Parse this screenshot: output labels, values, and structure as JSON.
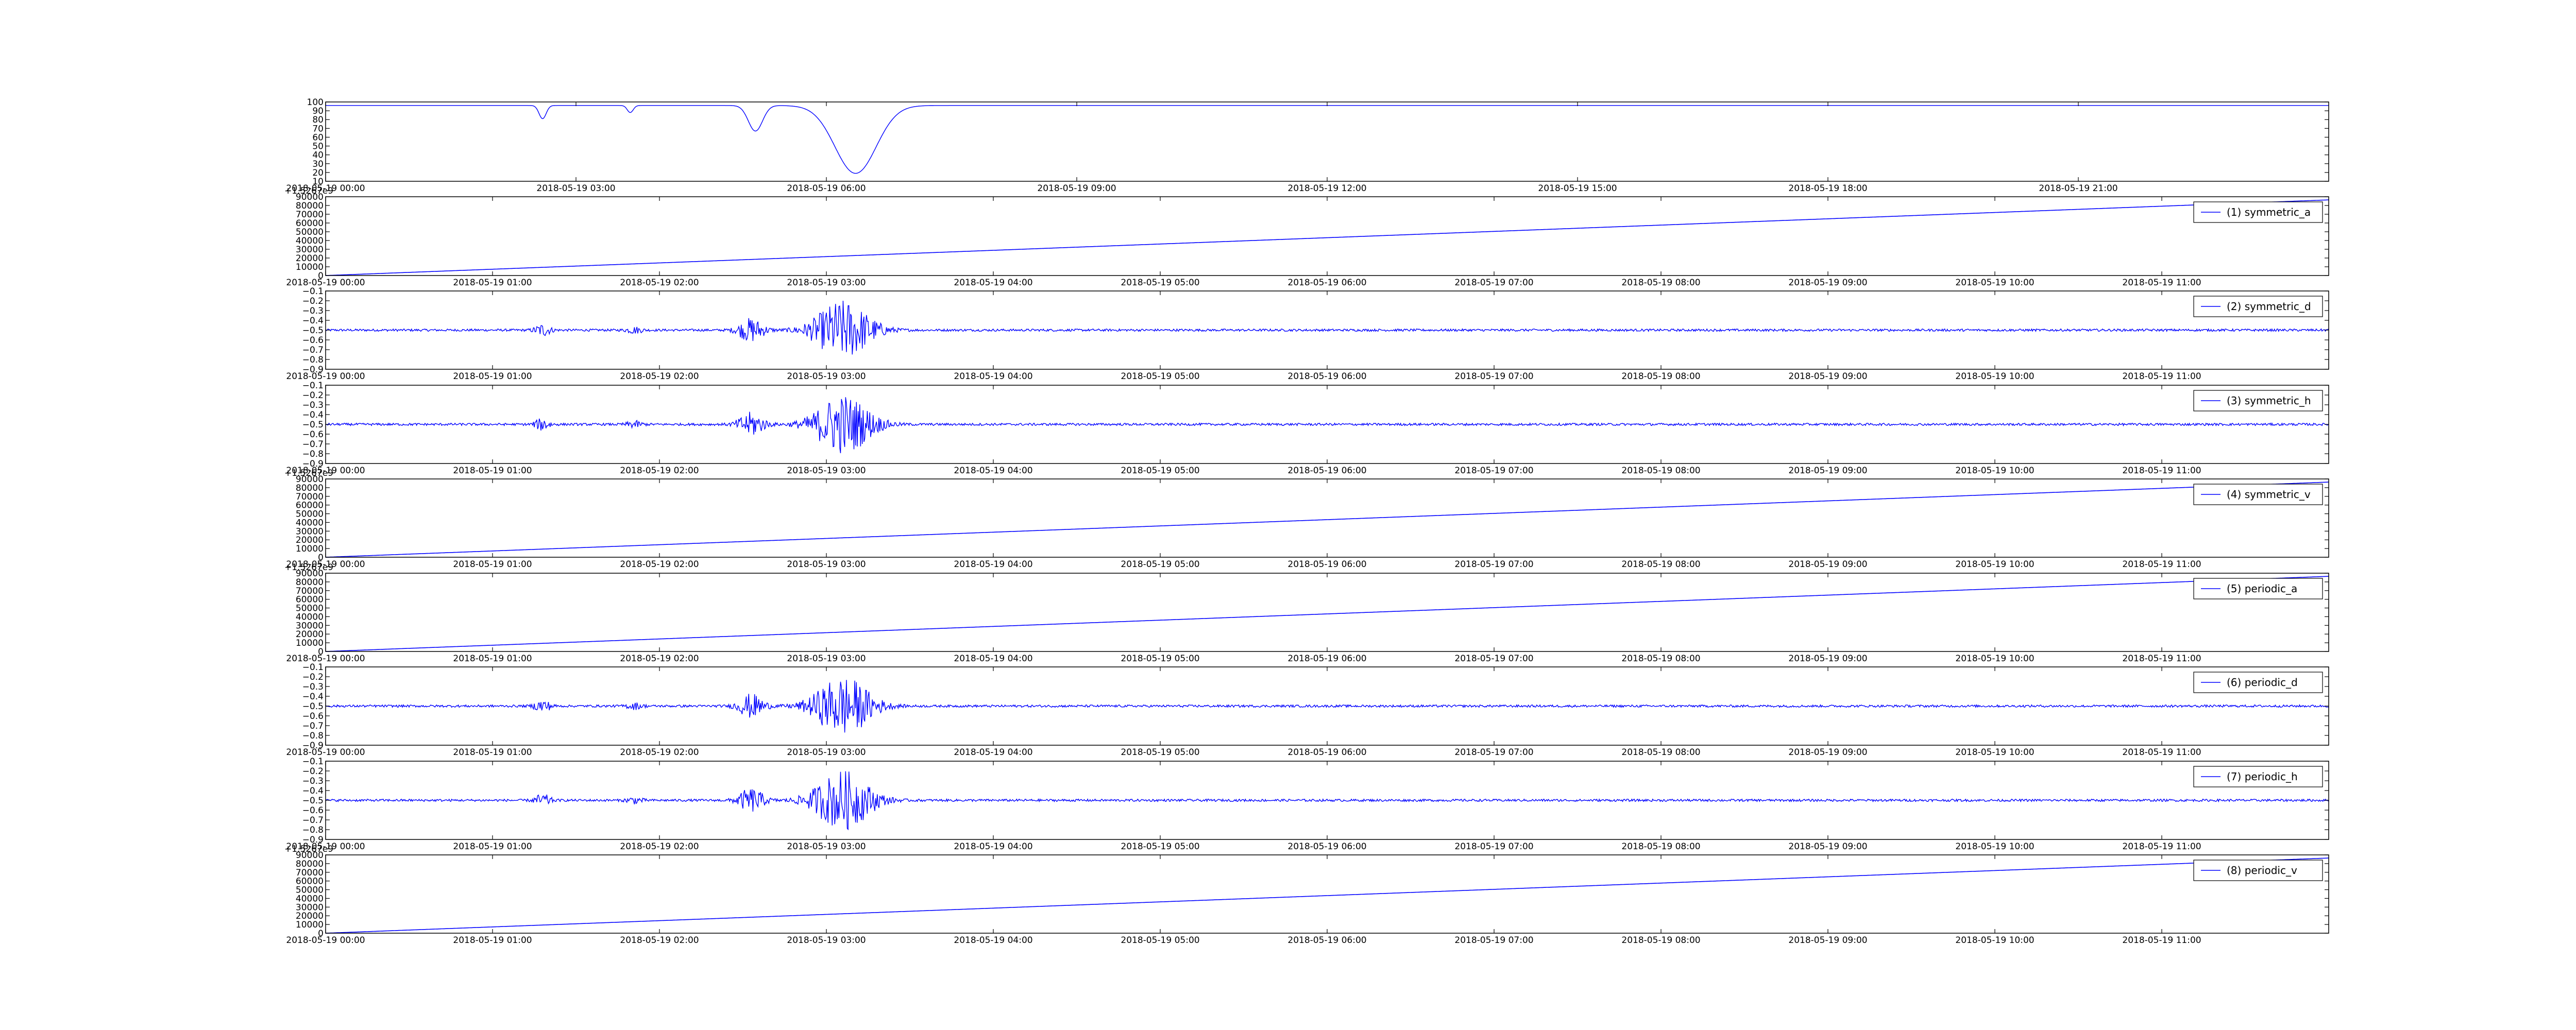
{
  "colors": {
    "series": "#0000ff",
    "axis": "#000000",
    "background": "#ffffff"
  },
  "chart_data": [
    {
      "type": "line",
      "title": "",
      "xlabel": "",
      "ylabel": "",
      "x_ticks": [
        "2018-05-19 00:00",
        "2018-05-19 03:00",
        "2018-05-19 06:00",
        "2018-05-19 09:00",
        "2018-05-19 12:00",
        "2018-05-19 15:00",
        "2018-05-19 18:00",
        "2018-05-19 21:00"
      ],
      "y_ticks": [
        "10",
        "20",
        "30",
        "40",
        "50",
        "60",
        "70",
        "80",
        "90",
        "100"
      ],
      "ylim": [
        10,
        100
      ],
      "xlim_hours": [
        0,
        24
      ],
      "baseline": 96,
      "dips": [
        {
          "hour": 2.6,
          "min": 81,
          "width_hours": 0.06
        },
        {
          "hour": 3.65,
          "min": 88,
          "width_hours": 0.05
        },
        {
          "hour": 5.15,
          "min": 67,
          "width_hours": 0.12
        },
        {
          "hour": 6.35,
          "min": 19,
          "width_hours": 0.35
        }
      ],
      "legend": ""
    },
    {
      "type": "line",
      "offset_text": "+1.5267e9",
      "x_ticks": [
        "2018-05-19 00:00",
        "2018-05-19 01:00",
        "2018-05-19 02:00",
        "2018-05-19 03:00",
        "2018-05-19 04:00",
        "2018-05-19 05:00",
        "2018-05-19 06:00",
        "2018-05-19 07:00",
        "2018-05-19 08:00",
        "2018-05-19 09:00",
        "2018-05-19 10:00",
        "2018-05-19 11:00"
      ],
      "y_ticks": [
        "0",
        "10000",
        "20000",
        "30000",
        "40000",
        "50000",
        "60000",
        "70000",
        "80000",
        "90000"
      ],
      "ylim": [
        0,
        90000
      ],
      "xlim_hours": [
        0,
        12
      ],
      "y_start": 0,
      "y_end": 86400,
      "legend": "(1) symmetric_a"
    },
    {
      "type": "line",
      "x_ticks": [
        "2018-05-19 00:00",
        "2018-05-19 01:00",
        "2018-05-19 02:00",
        "2018-05-19 03:00",
        "2018-05-19 04:00",
        "2018-05-19 05:00",
        "2018-05-19 06:00",
        "2018-05-19 07:00",
        "2018-05-19 08:00",
        "2018-05-19 09:00",
        "2018-05-19 10:00",
        "2018-05-19 11:00"
      ],
      "y_ticks": [
        "−0.9",
        "−0.8",
        "−0.7",
        "−0.6",
        "−0.5",
        "−0.4",
        "−0.3",
        "−0.2",
        "−0.1"
      ],
      "ylim": [
        -0.9,
        -0.1
      ],
      "xlim_hours": [
        0,
        12
      ],
      "center": -0.5,
      "noise": 0.012,
      "bursts": [
        {
          "hour": 1.3,
          "amp": 0.06,
          "width_hours": 0.05
        },
        {
          "hour": 1.85,
          "amp": 0.03,
          "width_hours": 0.05
        },
        {
          "hour": 2.55,
          "amp": 0.12,
          "width_hours": 0.08
        },
        {
          "hour": 3.1,
          "amp": 0.3,
          "width_hours": 0.18
        }
      ],
      "legend": "(2) symmetric_d"
    },
    {
      "type": "line",
      "x_ticks": [
        "2018-05-19 00:00",
        "2018-05-19 01:00",
        "2018-05-19 02:00",
        "2018-05-19 03:00",
        "2018-05-19 04:00",
        "2018-05-19 05:00",
        "2018-05-19 06:00",
        "2018-05-19 07:00",
        "2018-05-19 08:00",
        "2018-05-19 09:00",
        "2018-05-19 10:00",
        "2018-05-19 11:00"
      ],
      "y_ticks": [
        "−0.9",
        "−0.8",
        "−0.7",
        "−0.6",
        "−0.5",
        "−0.4",
        "−0.3",
        "−0.2",
        "−0.1"
      ],
      "ylim": [
        -0.9,
        -0.1
      ],
      "xlim_hours": [
        0,
        12
      ],
      "center": -0.5,
      "noise": 0.012,
      "bursts": [
        {
          "hour": 1.3,
          "amp": 0.06,
          "width_hours": 0.05
        },
        {
          "hour": 1.85,
          "amp": 0.03,
          "width_hours": 0.05
        },
        {
          "hour": 2.55,
          "amp": 0.12,
          "width_hours": 0.08
        },
        {
          "hour": 3.1,
          "amp": 0.3,
          "width_hours": 0.18
        }
      ],
      "legend": "(3) symmetric_h"
    },
    {
      "type": "line",
      "offset_text": "+1.5267e9",
      "x_ticks": [
        "2018-05-19 00:00",
        "2018-05-19 01:00",
        "2018-05-19 02:00",
        "2018-05-19 03:00",
        "2018-05-19 04:00",
        "2018-05-19 05:00",
        "2018-05-19 06:00",
        "2018-05-19 07:00",
        "2018-05-19 08:00",
        "2018-05-19 09:00",
        "2018-05-19 10:00",
        "2018-05-19 11:00"
      ],
      "y_ticks": [
        "0",
        "10000",
        "20000",
        "30000",
        "40000",
        "50000",
        "60000",
        "70000",
        "80000",
        "90000"
      ],
      "ylim": [
        0,
        90000
      ],
      "xlim_hours": [
        0,
        12
      ],
      "y_start": 0,
      "y_end": 86400,
      "legend": "(4) symmetric_v"
    },
    {
      "type": "line",
      "offset_text": "+1.5267e9",
      "x_ticks": [
        "2018-05-19 00:00",
        "2018-05-19 01:00",
        "2018-05-19 02:00",
        "2018-05-19 03:00",
        "2018-05-19 04:00",
        "2018-05-19 05:00",
        "2018-05-19 06:00",
        "2018-05-19 07:00",
        "2018-05-19 08:00",
        "2018-05-19 09:00",
        "2018-05-19 10:00",
        "2018-05-19 11:00"
      ],
      "y_ticks": [
        "0",
        "10000",
        "20000",
        "30000",
        "40000",
        "50000",
        "60000",
        "70000",
        "80000",
        "90000"
      ],
      "ylim": [
        0,
        90000
      ],
      "xlim_hours": [
        0,
        12
      ],
      "y_start": 0,
      "y_end": 86400,
      "legend": "(5) periodic_a"
    },
    {
      "type": "line",
      "x_ticks": [
        "2018-05-19 00:00",
        "2018-05-19 01:00",
        "2018-05-19 02:00",
        "2018-05-19 03:00",
        "2018-05-19 04:00",
        "2018-05-19 05:00",
        "2018-05-19 06:00",
        "2018-05-19 07:00",
        "2018-05-19 08:00",
        "2018-05-19 09:00",
        "2018-05-19 10:00",
        "2018-05-19 11:00"
      ],
      "y_ticks": [
        "−0.9",
        "−0.8",
        "−0.7",
        "−0.6",
        "−0.5",
        "−0.4",
        "−0.3",
        "−0.2",
        "−0.1"
      ],
      "ylim": [
        -0.9,
        -0.1
      ],
      "xlim_hours": [
        0,
        12
      ],
      "center": -0.5,
      "noise": 0.012,
      "bursts": [
        {
          "hour": 1.3,
          "amp": 0.06,
          "width_hours": 0.05
        },
        {
          "hour": 1.85,
          "amp": 0.03,
          "width_hours": 0.05
        },
        {
          "hour": 2.55,
          "amp": 0.12,
          "width_hours": 0.08
        },
        {
          "hour": 3.1,
          "amp": 0.3,
          "width_hours": 0.18
        }
      ],
      "legend": "(6) periodic_d"
    },
    {
      "type": "line",
      "x_ticks": [
        "2018-05-19 00:00",
        "2018-05-19 01:00",
        "2018-05-19 02:00",
        "2018-05-19 03:00",
        "2018-05-19 04:00",
        "2018-05-19 05:00",
        "2018-05-19 06:00",
        "2018-05-19 07:00",
        "2018-05-19 08:00",
        "2018-05-19 09:00",
        "2018-05-19 10:00",
        "2018-05-19 11:00"
      ],
      "y_ticks": [
        "−0.9",
        "−0.8",
        "−0.7",
        "−0.6",
        "−0.5",
        "−0.4",
        "−0.3",
        "−0.2",
        "−0.1"
      ],
      "ylim": [
        -0.9,
        -0.1
      ],
      "xlim_hours": [
        0,
        12
      ],
      "center": -0.5,
      "noise": 0.012,
      "bursts": [
        {
          "hour": 1.3,
          "amp": 0.06,
          "width_hours": 0.05
        },
        {
          "hour": 1.85,
          "amp": 0.03,
          "width_hours": 0.05
        },
        {
          "hour": 2.55,
          "amp": 0.12,
          "width_hours": 0.08
        },
        {
          "hour": 3.1,
          "amp": 0.3,
          "width_hours": 0.18
        }
      ],
      "legend": "(7) periodic_h"
    },
    {
      "type": "line",
      "offset_text": "+1.5267e9",
      "x_ticks": [
        "2018-05-19 00:00",
        "2018-05-19 01:00",
        "2018-05-19 02:00",
        "2018-05-19 03:00",
        "2018-05-19 04:00",
        "2018-05-19 05:00",
        "2018-05-19 06:00",
        "2018-05-19 07:00",
        "2018-05-19 08:00",
        "2018-05-19 09:00",
        "2018-05-19 10:00",
        "2018-05-19 11:00"
      ],
      "y_ticks": [
        "0",
        "10000",
        "20000",
        "30000",
        "40000",
        "50000",
        "60000",
        "70000",
        "80000",
        "90000"
      ],
      "ylim": [
        0,
        90000
      ],
      "xlim_hours": [
        0,
        12
      ],
      "y_start": 0,
      "y_end": 86400,
      "legend": "(8) periodic_v"
    }
  ]
}
